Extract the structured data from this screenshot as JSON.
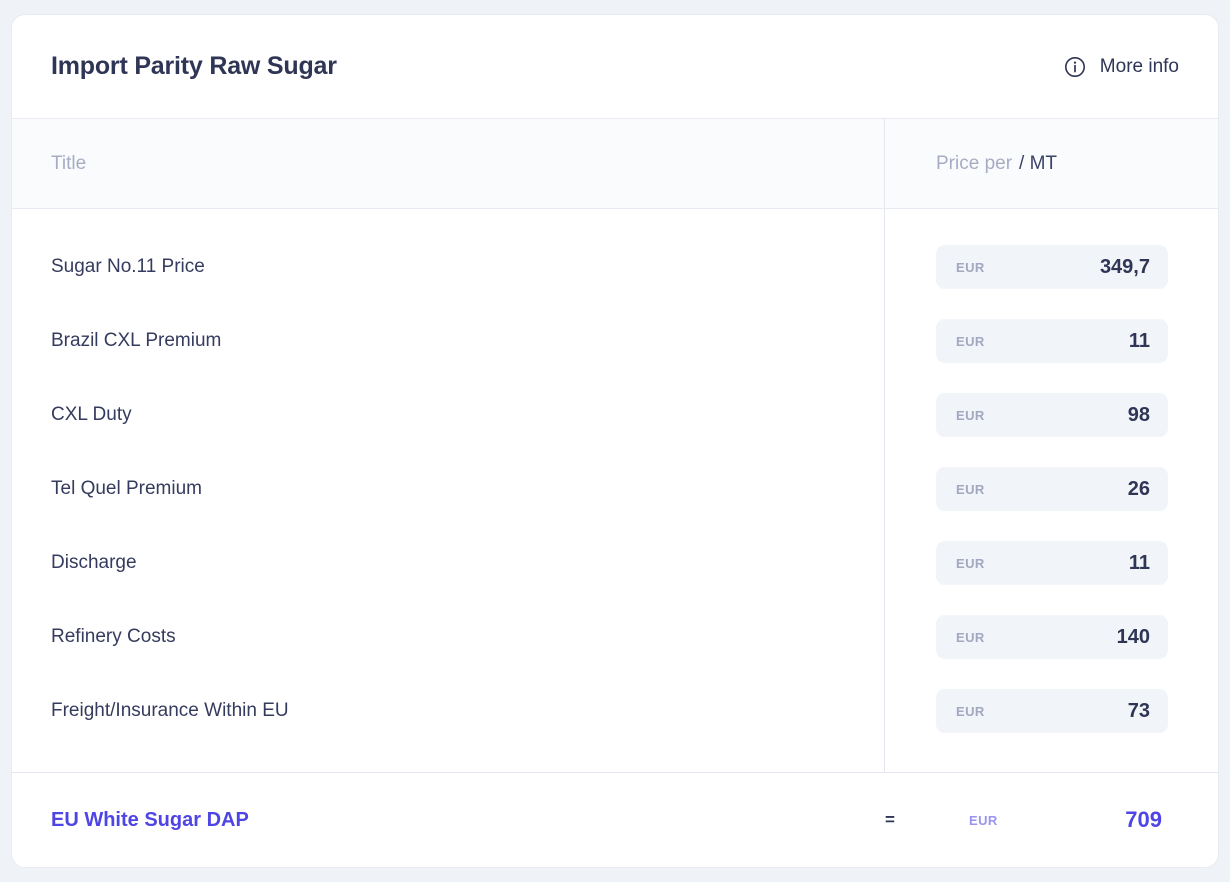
{
  "header": {
    "title": "Import Parity Raw Sugar",
    "more_info_label": "More info",
    "info_icon": "info-circle-icon"
  },
  "table": {
    "columns": {
      "title": "Title",
      "price_prefix": "Price per",
      "price_unit": "/ MT"
    },
    "rows": [
      {
        "label": "Sugar No.11 Price",
        "currency": "EUR",
        "value": "349,7"
      },
      {
        "label": "Brazil CXL Premium",
        "currency": "EUR",
        "value": "11"
      },
      {
        "label": "CXL Duty",
        "currency": "EUR",
        "value": "98"
      },
      {
        "label": "Tel Quel Premium",
        "currency": "EUR",
        "value": "26"
      },
      {
        "label": "Discharge",
        "currency": "EUR",
        "value": "11"
      },
      {
        "label": "Refinery Costs",
        "currency": "EUR",
        "value": "140"
      },
      {
        "label": "Freight/Insurance Within EU",
        "currency": "EUR",
        "value": "73"
      }
    ]
  },
  "total": {
    "label": "EU White Sugar DAP",
    "operator": "=",
    "currency": "EUR",
    "value": "709"
  },
  "colors": {
    "page_background": "#eff2f7",
    "card_background": "#ffffff",
    "border": "#e8ebf1",
    "text_primary": "#2f3555",
    "text_muted": "#a7acc4",
    "pill_background": "#f1f4f9",
    "accent": "#4f45e4"
  }
}
